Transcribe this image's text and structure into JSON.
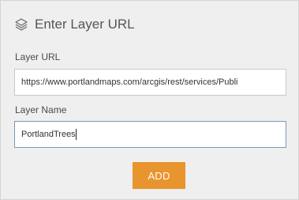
{
  "header": {
    "icon": "layers-icon",
    "title": "Enter Layer URL"
  },
  "form": {
    "url_label": "Layer URL",
    "url_value": "https://www.portlandmaps.com/arcgis/rest/services/Publi",
    "name_label": "Layer Name",
    "name_value": "PortlandTrees"
  },
  "actions": {
    "add_label": "ADD"
  },
  "colors": {
    "panel_bg": "#efefef",
    "accent": "#e8942f",
    "focus_border": "#7a97b8"
  }
}
